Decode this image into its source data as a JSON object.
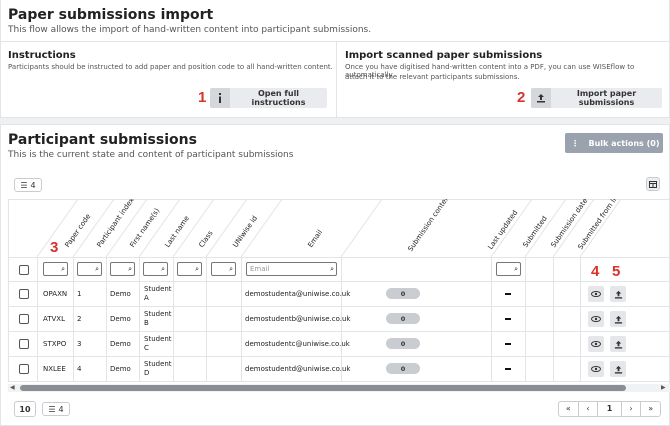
{
  "import_section": {
    "title": "Paper submissions import",
    "subtitle": "This flow allows the import of hand-written content into participant submissions."
  },
  "instructions": {
    "title": "Instructions",
    "text": "Participants should be instructed to add paper and position code to all hand-written content.",
    "button_label": "Open full instructions",
    "icon": "info-icon",
    "callout": "1"
  },
  "import_scanned": {
    "title": "Import scanned paper submissions",
    "text_line1": "Once you have digitised hand-written content into a PDF, you can use WISEflow to automatically",
    "text_line2": "attach it to the relevant participants submissions.",
    "button_label": "Import paper submissions",
    "icon": "upload-icon",
    "callout": "2"
  },
  "participants": {
    "title": "Participant submissions",
    "subtitle": "This is the current state and content of participant submissions",
    "bulk_actions_label": "Bulk actions (0)",
    "columns_count": "4",
    "columns": [
      "Paper code",
      "Participant index",
      "First name(s)",
      "Last name",
      "Class",
      "UNIwise id",
      "Email",
      "Submission content",
      "Last updated",
      "Submitted",
      "Submission date",
      "Submitted from IP"
    ],
    "email_placeholder": "Email",
    "callouts": {
      "filter": "3",
      "view": "4",
      "upload": "5"
    },
    "rows": [
      {
        "code": "OPAXN",
        "index": "1",
        "first": "Demo",
        "last": "Student A",
        "last1": "Student",
        "last2": "A",
        "email": "demostudenta@uniwise.co.uk",
        "content": "0",
        "updated": "–"
      },
      {
        "code": "ATVXL",
        "index": "2",
        "first": "Demo",
        "last": "Student B",
        "last1": "Student",
        "last2": "B",
        "email": "demostudentb@uniwise.co.uk",
        "content": "0",
        "updated": "–"
      },
      {
        "code": "STXPO",
        "index": "3",
        "first": "Demo",
        "last": "Student C",
        "last1": "Student",
        "last2": "C",
        "email": "demostudentc@uniwise.co.uk",
        "content": "0",
        "updated": "–"
      },
      {
        "code": "NXLEE",
        "index": "4",
        "first": "Demo",
        "last": "Student D",
        "last1": "Student",
        "last2": "D",
        "email": "demostudentd@uniwise.co.uk",
        "content": "0",
        "updated": "–"
      }
    ]
  },
  "footer": {
    "page_size": "10",
    "columns_count": "4",
    "current_page": "1"
  },
  "colors": {
    "callout": "#d8322b",
    "button_bg": "#e9ebee",
    "bulk_bg": "#9aa3ad"
  }
}
